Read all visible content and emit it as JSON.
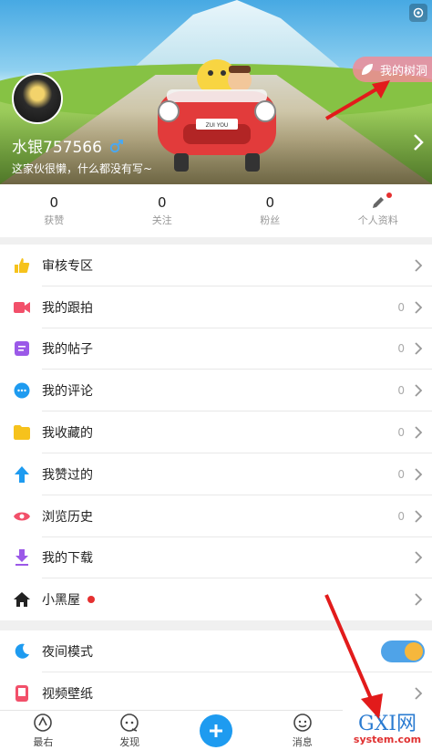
{
  "profile": {
    "username": "水银757566",
    "gender_icon": "male-icon",
    "signature": "这家伙很懒，什么都没有写~",
    "treehole_label": "我的树洞",
    "car_plate": "ZUI YOU"
  },
  "stats": [
    {
      "value": "0",
      "label": "获赞"
    },
    {
      "value": "0",
      "label": "关注"
    },
    {
      "value": "0",
      "label": "粉丝"
    },
    {
      "label": "个人资料",
      "icon": "pencil-icon",
      "has_dot": true
    }
  ],
  "menu": [
    {
      "label": "审核专区",
      "icon": "thumbs-up-icon",
      "color": "#f6c21c",
      "count": ""
    },
    {
      "label": "我的跟拍",
      "icon": "video-camera-icon",
      "color": "#f2506a",
      "count": "0"
    },
    {
      "label": "我的帖子",
      "icon": "document-icon",
      "color": "#9b59e8",
      "count": "0"
    },
    {
      "label": "我的评论",
      "icon": "comment-icon",
      "color": "#1e9bf0",
      "count": "0"
    },
    {
      "label": "我收藏的",
      "icon": "folder-icon",
      "color": "#f6c21c",
      "count": "0"
    },
    {
      "label": "我赞过的",
      "icon": "arrow-up-icon",
      "color": "#1e9bf0",
      "count": "0"
    },
    {
      "label": "浏览历史",
      "icon": "eye-icon",
      "color": "#f2506a",
      "count": "0"
    },
    {
      "label": "我的下载",
      "icon": "download-icon",
      "color": "#9b59e8",
      "count": ""
    },
    {
      "label": "小黑屋",
      "icon": "house-icon",
      "color": "#222222",
      "count": "",
      "has_dot": true
    }
  ],
  "settings": [
    {
      "label": "夜间模式",
      "icon": "moon-icon",
      "color": "#1e9bf0",
      "toggle": true
    },
    {
      "label": "视频壁纸",
      "icon": "phone-icon",
      "color": "#f2506a"
    }
  ],
  "tabs": [
    {
      "label": "最右",
      "icon": "logo-icon"
    },
    {
      "label": "发现",
      "icon": "discover-icon"
    },
    {
      "label": "",
      "icon": "plus-icon"
    },
    {
      "label": "消息",
      "icon": "message-icon"
    }
  ],
  "watermark": {
    "big": "GXI网",
    "small": "system.com"
  },
  "colors": {
    "accent": "#1e9bf0",
    "red": "#e53030"
  }
}
